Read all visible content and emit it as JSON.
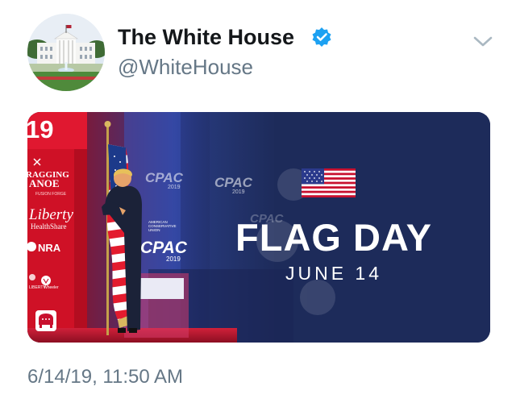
{
  "tweet": {
    "display_name": "The White House",
    "handle": "@WhiteHouse",
    "verified": true,
    "timestamp": "6/14/19, 11:50 AM",
    "menu_icon": "chevron-down-icon"
  },
  "avatar": {
    "icon": "white-house-building-icon"
  },
  "media": {
    "headline": "FLAG DAY",
    "date": "JUNE 14",
    "flag_icon": "us-flag-icon",
    "stage_year": "19",
    "sign_ragging": "RAGGING",
    "sign_anoe": "ANOE",
    "sign_fine": "FUSION FORGE",
    "liberty": "Liberty",
    "liberty_sub": "HealthShare",
    "nra": "NRA",
    "sign_bottom": "LIBERTY",
    "sign_bottom2": "Wheeler",
    "cpac_label": "CPAC",
    "cpac_year": "2019",
    "cpac_small": "AMERICAN CONSERVATIVE UNION",
    "gop_icon": "republican-elephant-icon"
  },
  "colors": {
    "navy": "#1d2b5a",
    "stage_red": "#c8102e",
    "verified_blue": "#1da1f2",
    "muted_gray": "#657786"
  }
}
